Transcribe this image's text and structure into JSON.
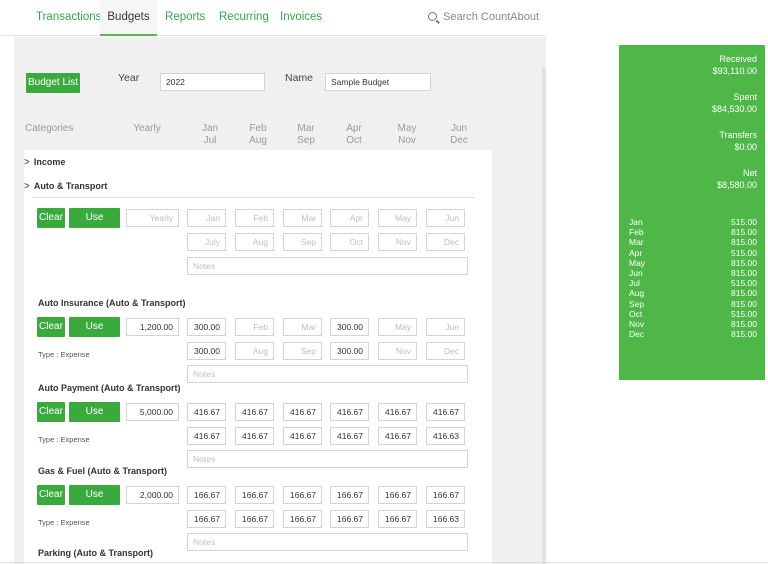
{
  "nav": {
    "tabs": [
      "Transactions",
      "Budgets",
      "Reports",
      "Recurring",
      "Invoices"
    ],
    "active": "Budgets",
    "search_label": "Search CountAbout",
    "search_icon": "search-icon"
  },
  "budget_header": {
    "budget_list_label": "Budget List",
    "year_label": "Year",
    "year_value": "2022",
    "name_label": "Name",
    "name_value": "Sample Budget"
  },
  "columns": {
    "categories": "Categories",
    "yearly": "Yearly",
    "months_top": [
      "Jan",
      "Feb",
      "Mar",
      "Apr",
      "May",
      "Jun"
    ],
    "months_bottom": [
      "Jul",
      "Aug",
      "Sep",
      "Oct",
      "Nov",
      "Dec"
    ]
  },
  "groups": [
    {
      "label": "Income"
    },
    {
      "label": "Auto & Transport"
    }
  ],
  "buttons": {
    "clear": "Clear",
    "use_history": "Use History"
  },
  "new_entry": {
    "yearly_placeholder": "Yearly",
    "top_placeholders": [
      "Jan",
      "Feb",
      "Mar",
      "Apr",
      "May",
      "Jun"
    ],
    "bottom_placeholders": [
      "July",
      "Aug",
      "Sep",
      "Oct",
      "Nov",
      "Dec"
    ],
    "notes_placeholder": "Notes"
  },
  "categories": [
    {
      "title": "Auto Insurance (Auto & Transport)",
      "yearly": "1,200.00",
      "type": "Type : Expense",
      "top": [
        "300.00",
        "Feb",
        "Mar",
        "300.00",
        "May",
        "Jun"
      ],
      "bottom": [
        "300.00",
        "Aug",
        "Sep",
        "300.00",
        "Nov",
        "Dec"
      ],
      "notes": "Notes"
    },
    {
      "title": "Auto Payment (Auto & Transport)",
      "yearly": "5,000.00",
      "type": "Type : Expense",
      "top": [
        "416.67",
        "416.67",
        "416.67",
        "416.67",
        "416.67",
        "416.67"
      ],
      "bottom": [
        "416.67",
        "416.67",
        "416.67",
        "416.67",
        "416.67",
        "416.63"
      ],
      "notes": "Notes"
    },
    {
      "title": "Gas & Fuel (Auto & Transport)",
      "yearly": "2,000.00",
      "type": "Type : Expense",
      "top": [
        "166.67",
        "166.67",
        "166.67",
        "166.67",
        "166.67",
        "166.67"
      ],
      "bottom": [
        "166.67",
        "166.67",
        "166.67",
        "166.67",
        "166.67",
        "166.63"
      ],
      "notes": "Notes"
    },
    {
      "title": "Parking (Auto & Transport)"
    }
  ],
  "summary": {
    "received_label": "Received",
    "received_value": "$93,110.00",
    "spent_label": "Spent",
    "spent_value": "$84,530.00",
    "transfers_label": "Transfers",
    "transfers_value": "$0.00",
    "net_label": "Net",
    "net_value": "$8,580.00",
    "months": [
      {
        "m": "Jan",
        "v": "515.00"
      },
      {
        "m": "Feb",
        "v": "815.00"
      },
      {
        "m": "Mar",
        "v": "815.00"
      },
      {
        "m": "Apr",
        "v": "515.00"
      },
      {
        "m": "May",
        "v": "815.00"
      },
      {
        "m": "Jun",
        "v": "815.00"
      },
      {
        "m": "Jul",
        "v": "515.00"
      },
      {
        "m": "Aug",
        "v": "815.00"
      },
      {
        "m": "Sep",
        "v": "815.00"
      },
      {
        "m": "Oct",
        "v": "515.00"
      },
      {
        "m": "Nov",
        "v": "815.00"
      },
      {
        "m": "Dec",
        "v": "815.00"
      }
    ],
    "background": "#4eb748"
  },
  "colors": {
    "accent": "#3aaa3e",
    "nav_green": "#3aa34a",
    "panel": "#f0f0f0"
  }
}
